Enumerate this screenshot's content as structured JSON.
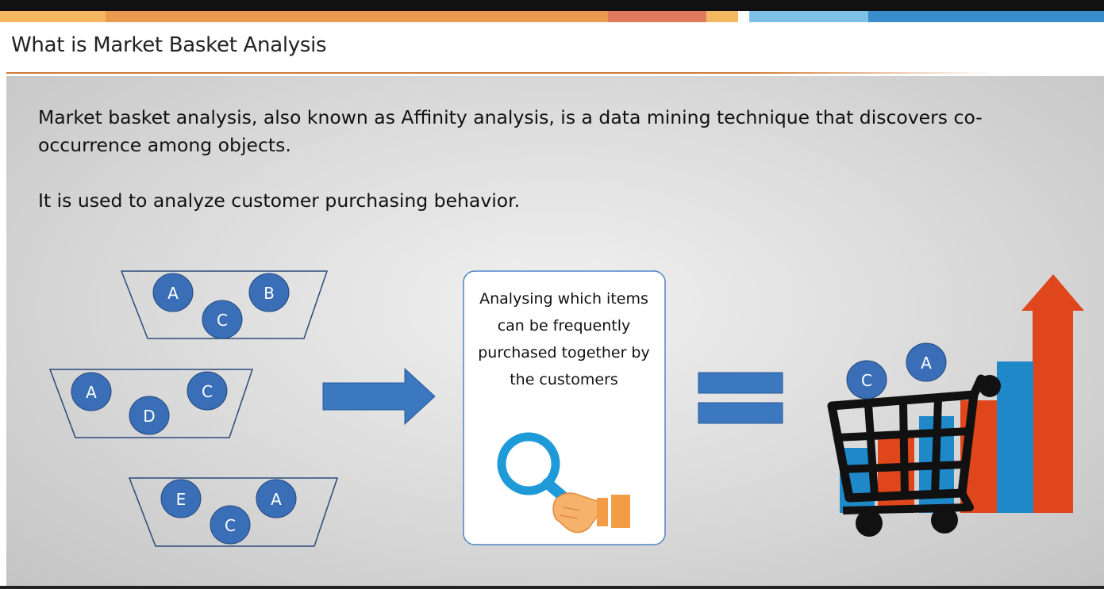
{
  "slide": {
    "title": "What is Market Basket Analysis",
    "paragraph1": "Market basket analysis, also known as Affinity analysis, is a data mining technique that discovers co-occurrence among objects.",
    "paragraph2": "It is used to analyze customer purchasing behavior."
  },
  "baskets": [
    {
      "items": [
        "A",
        "B",
        "C"
      ]
    },
    {
      "items": [
        "A",
        "D",
        "C"
      ]
    },
    {
      "items": [
        "E",
        "A",
        "C"
      ]
    }
  ],
  "analysis_box": {
    "text": "Analysing which items can be frequently purchased together by the customers",
    "icon": "magnifying-glass-in-hand-icon"
  },
  "cart_items": [
    "C",
    "A"
  ],
  "icons": {
    "arrow": "right-arrow-icon",
    "equals": "equals-sign-icon",
    "cart": "shopping-cart-icon",
    "growth": "growth-bar-chart-icon"
  },
  "colors": {
    "accent_orange": "#d07a32",
    "item_fill": "#3a6fb8",
    "bar_blue": "#1e88c8",
    "bar_red": "#e0461c"
  }
}
